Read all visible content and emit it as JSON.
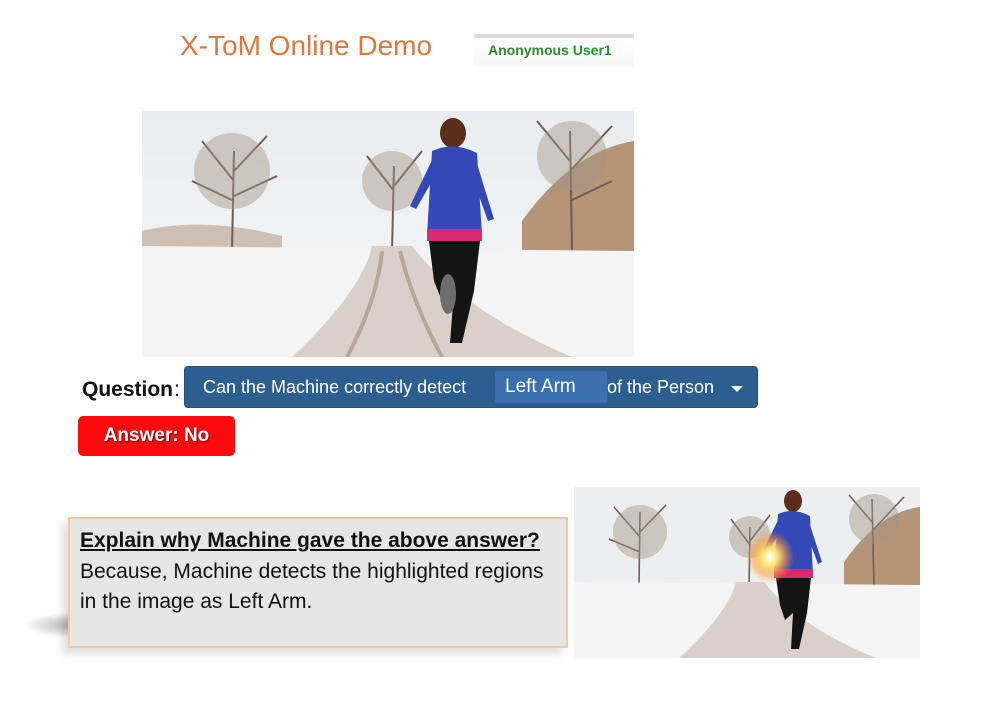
{
  "header": {
    "title": "X-ToM Online Demo",
    "user": "Anonymous User1"
  },
  "question": {
    "label": "Question",
    "prefix": "Can the Machine correctly detect",
    "selected_part": "Left Arm",
    "suffix": "of the Person"
  },
  "answer": {
    "label": "Answer: No"
  },
  "explanation": {
    "heading": "Explain why Machine gave the above answer?",
    "body": "Because, Machine detects the highlighted regions in the image as Left Arm."
  },
  "colors": {
    "title": "#d9783f",
    "user_text": "#2e8b2e",
    "question_bar": "#2c5f8f",
    "answer_bg": "#ff0a0a"
  },
  "images": {
    "main_photo": "runner-in-snow-photo",
    "explanation_photo": "runner-heatmap-photo"
  }
}
